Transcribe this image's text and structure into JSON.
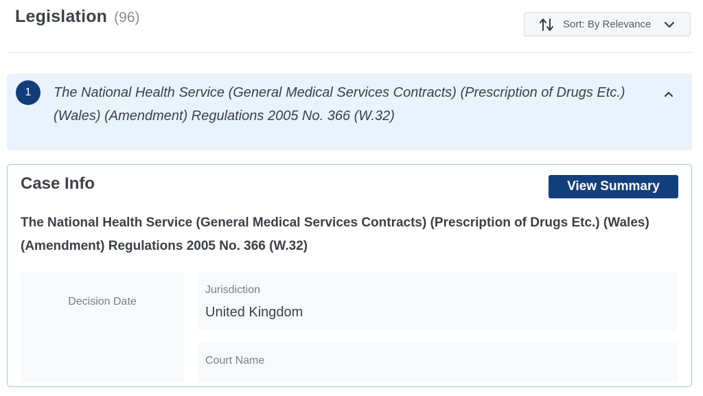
{
  "header": {
    "title": "Legislation",
    "count": "(96)"
  },
  "sort": {
    "label": "Sort: By Relevance",
    "icon": "sort-arrows-icon"
  },
  "result": {
    "number": "1",
    "title": "The National Health Service (General Medical Services Contracts) (Prescription of Drugs Etc.) (Wales) (Amendment) Regulations 2005 No. 366 (W.32)"
  },
  "case_info": {
    "heading": "Case Info",
    "view_summary_label": "View Summary",
    "title": "The National Health Service (General Medical Services Contracts) (Prescription of Drugs Etc.) (Wales) (Amendment) Regulations 2005 No. 366 (W.32)",
    "decision_date_label": "Decision Date",
    "jurisdiction_label": "Jurisdiction",
    "jurisdiction_value": "United Kingdom",
    "court_name_label": "Court Name"
  },
  "colors": {
    "primary": "#143f7d",
    "accordion_bg": "#e8f3fd",
    "card_border": "#9cc9ec"
  }
}
